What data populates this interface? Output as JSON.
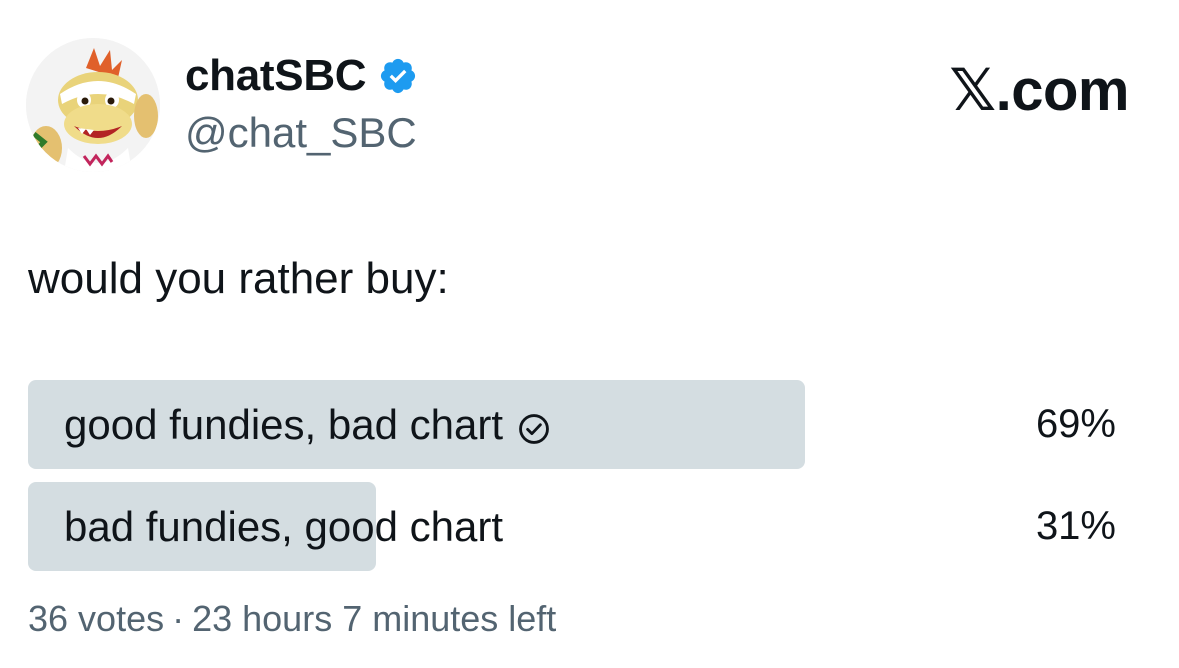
{
  "author": {
    "display_name": "chatSBC",
    "handle": "@chat_SBC",
    "verified": true,
    "verified_icon": "verified-badge-icon",
    "avatar_icon": "avatar-image",
    "badge_color": "#1d9bf0"
  },
  "site_mark": "𝕏.com",
  "tweet": {
    "text": "would you rather buy:"
  },
  "poll": {
    "options": [
      {
        "label": "good fundies, bad chart",
        "percent_label": "69%",
        "percent": 69,
        "winner": true,
        "winner_icon": "check-circle-icon"
      },
      {
        "label": "bad fundies, good chart",
        "percent_label": "31%",
        "percent": 31,
        "winner": false
      }
    ],
    "votes": "36 votes",
    "separator": "·",
    "time_left": "23 hours 7 minutes left",
    "bar_color": "#cfd9de"
  }
}
